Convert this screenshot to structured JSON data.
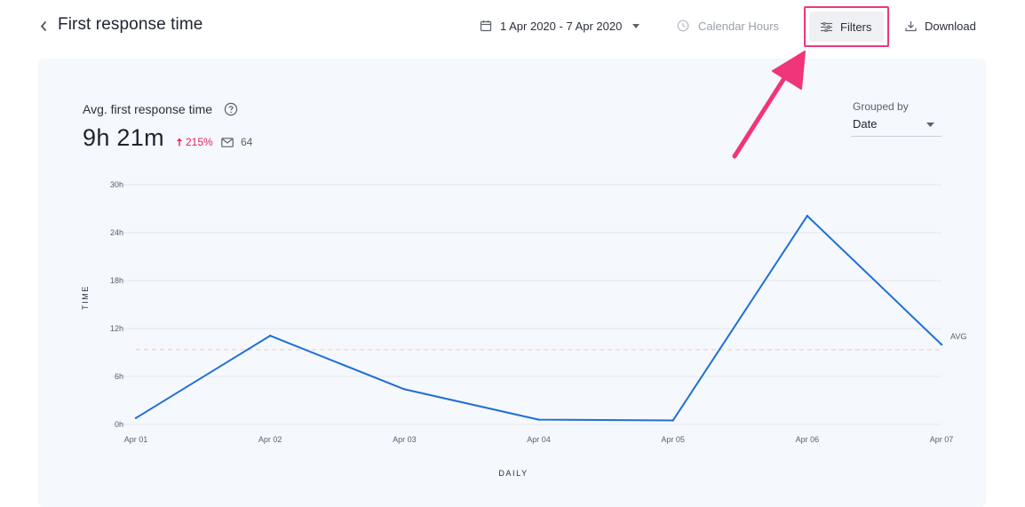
{
  "header": {
    "title": "First response time",
    "date_range": "1 Apr 2020 - 7 Apr 2020",
    "calendar_hours": "Calendar Hours",
    "filters": "Filters",
    "download": "Download"
  },
  "metric": {
    "title": "Avg. first response time",
    "value": "9h 21m",
    "trend": "215%",
    "count": "64"
  },
  "grouped_by": {
    "label": "Grouped by",
    "value": "Date"
  },
  "colors": {
    "line": "#1f6fd6",
    "avg_line": "#f3c7b8",
    "highlight": "#f0357a",
    "trend_up": "#e3245c"
  },
  "chart_data": {
    "type": "line",
    "categories": [
      "Apr 01",
      "Apr 02",
      "Apr 03",
      "Apr 04",
      "Apr 05",
      "Apr 06",
      "Apr 07"
    ],
    "series": [
      {
        "values": [
          0.8,
          11.1,
          4.4,
          0.6,
          0.5,
          26.1,
          10.0
        ]
      }
    ],
    "avg": 9.35,
    "avg_label": "AVG",
    "y_ticks": [
      0,
      6,
      12,
      18,
      24,
      30
    ],
    "y_tick_labels": [
      "0h",
      "6h",
      "12h",
      "18h",
      "24h",
      "30h"
    ],
    "ylim": [
      0,
      30
    ],
    "ylabel": "TIME",
    "xlabel": "DAILY",
    "grid": true
  }
}
